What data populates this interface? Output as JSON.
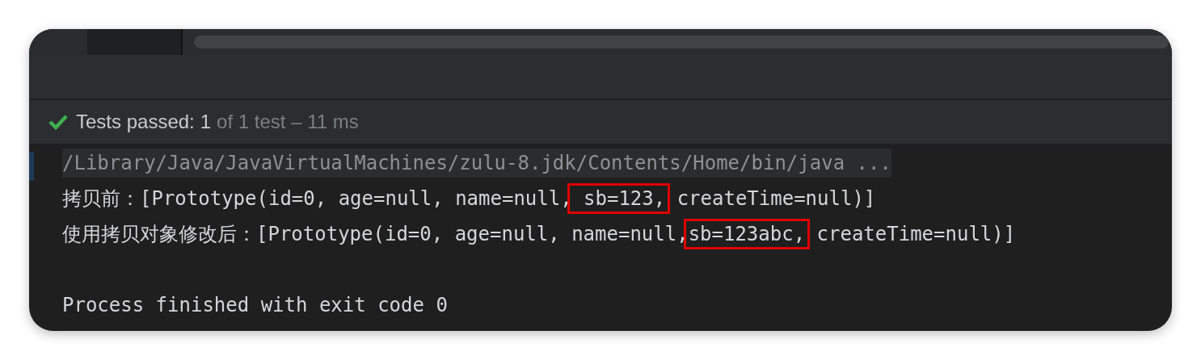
{
  "status": {
    "passed": true,
    "label": "Tests passed:",
    "count": "1",
    "detail": "of 1 test – 11 ms"
  },
  "console": {
    "lines": [
      {
        "kind": "command",
        "segments": [
          {
            "text": "/Library/Java/JavaVirtualMachines/zulu-8.jdk/Contents/Home/bin/java ...",
            "highlighted": false
          }
        ]
      },
      {
        "kind": "output",
        "segments": [
          {
            "text": "拷贝前：[Prototype(id=0, age=null, name=null,",
            "highlighted": false
          },
          {
            "text": " sb=123,",
            "highlighted": true
          },
          {
            "text": " createTime=null)]",
            "highlighted": false
          }
        ]
      },
      {
        "kind": "output",
        "segments": [
          {
            "text": "使用拷贝对象修改后：[Prototype(id=0, age=null, name=null,",
            "highlighted": false
          },
          {
            "text": "sb=123abc,",
            "highlighted": true
          },
          {
            "text": " createTime=null)]",
            "highlighted": false
          }
        ]
      },
      {
        "kind": "exit",
        "segments": [
          {
            "text": "Process finished with exit code 0",
            "highlighted": false
          }
        ]
      }
    ]
  }
}
